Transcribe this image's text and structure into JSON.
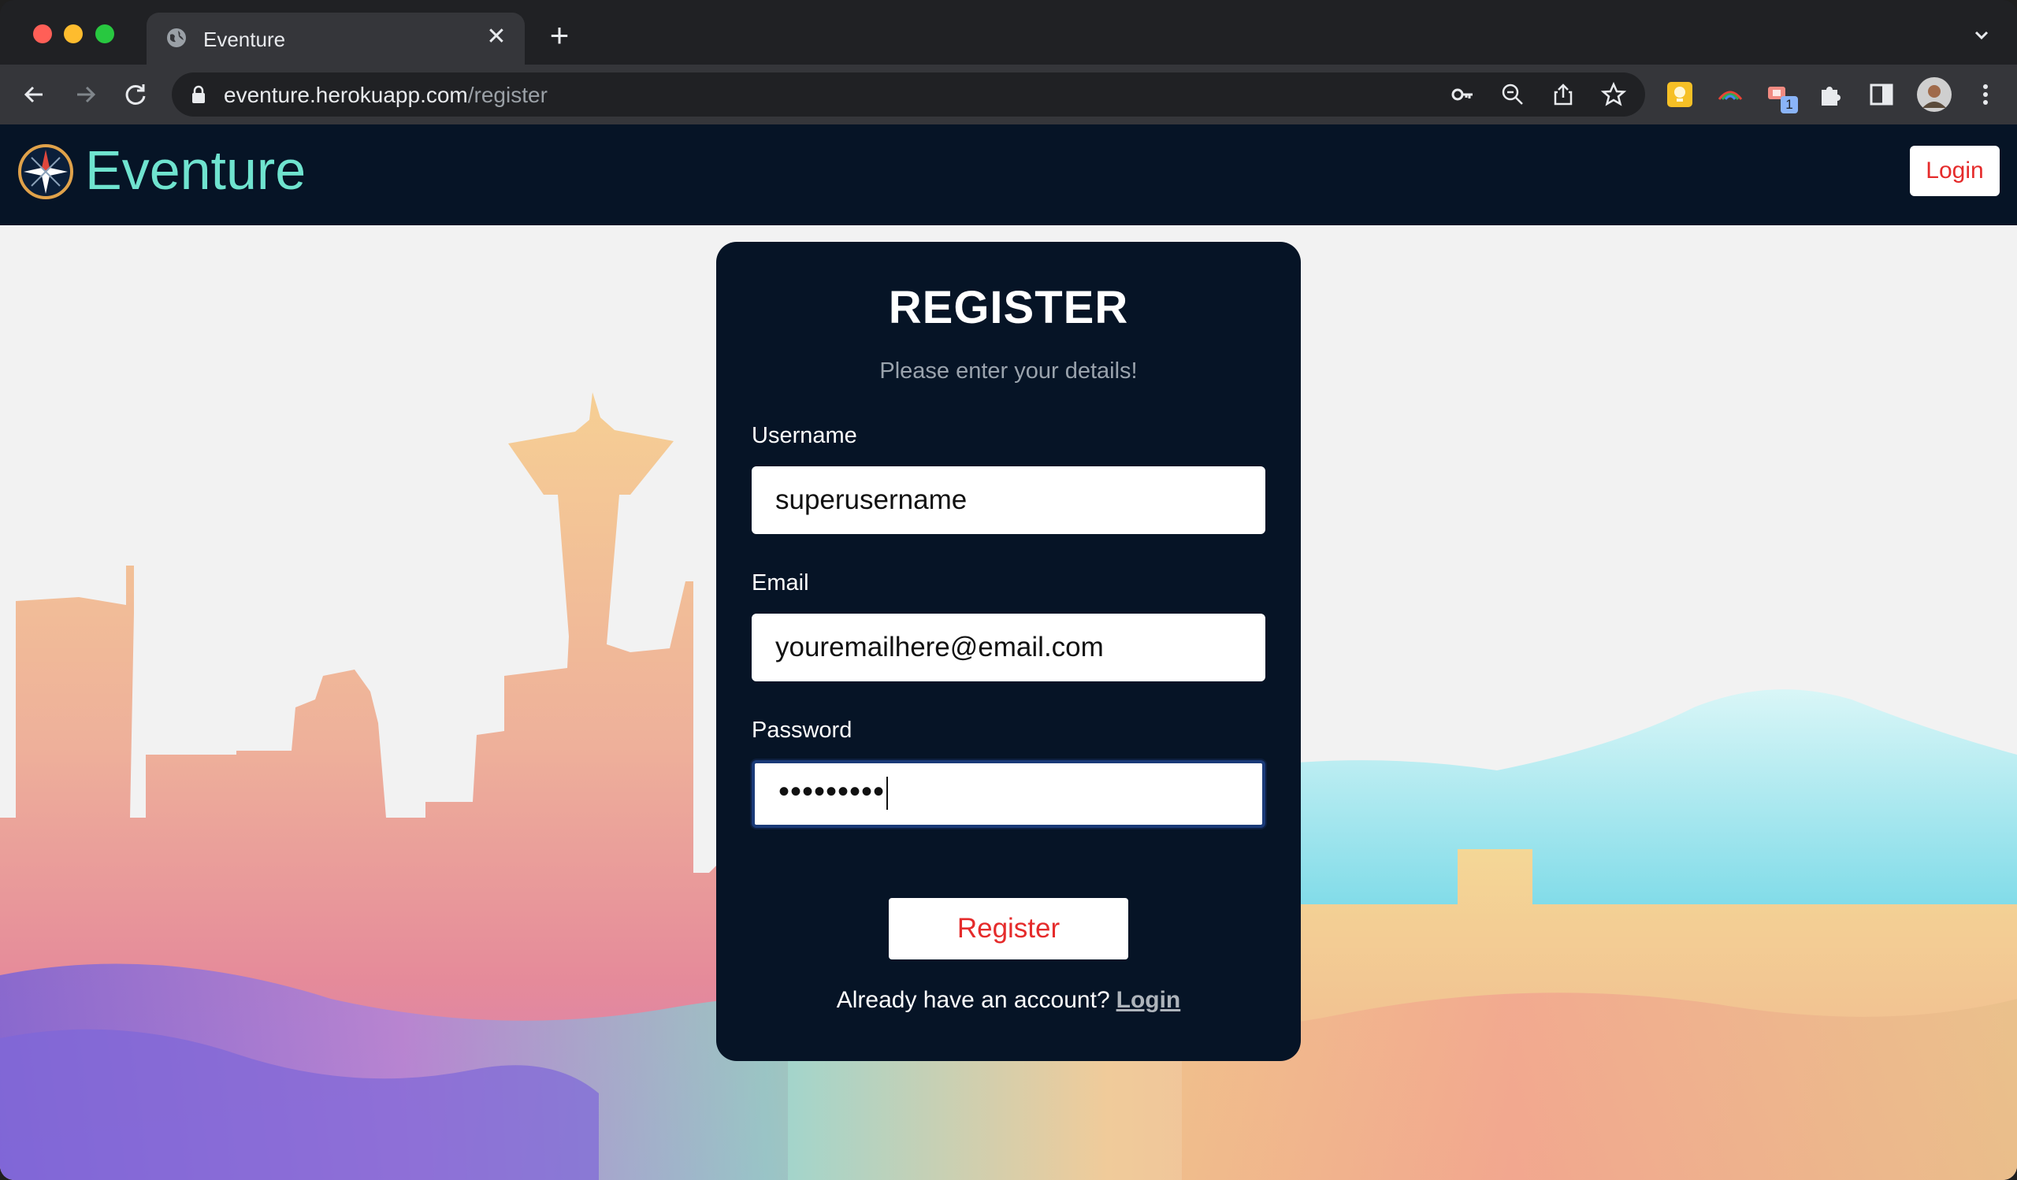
{
  "browser": {
    "tab_title": "Eventure",
    "tab_close": "✕",
    "new_tab": "+",
    "url_domain": "eventure.herokuapp.com",
    "url_path": "/register",
    "extension_badge": "1"
  },
  "navbar": {
    "brand": "Eventure",
    "login_label": "Login",
    "brand_color": "#6fe3cf",
    "background": "#061426"
  },
  "form": {
    "title": "REGISTER",
    "subtitle": "Please enter your details!",
    "username_label": "Username",
    "username_value": "superusername",
    "email_label": "Email",
    "email_value": "youremailhere@email.com",
    "password_label": "Password",
    "password_masked": "•••••••••",
    "submit_label": "Register",
    "footer_text": "Already have an account?",
    "footer_link": "Login",
    "accent_color": "#e52b2b"
  }
}
